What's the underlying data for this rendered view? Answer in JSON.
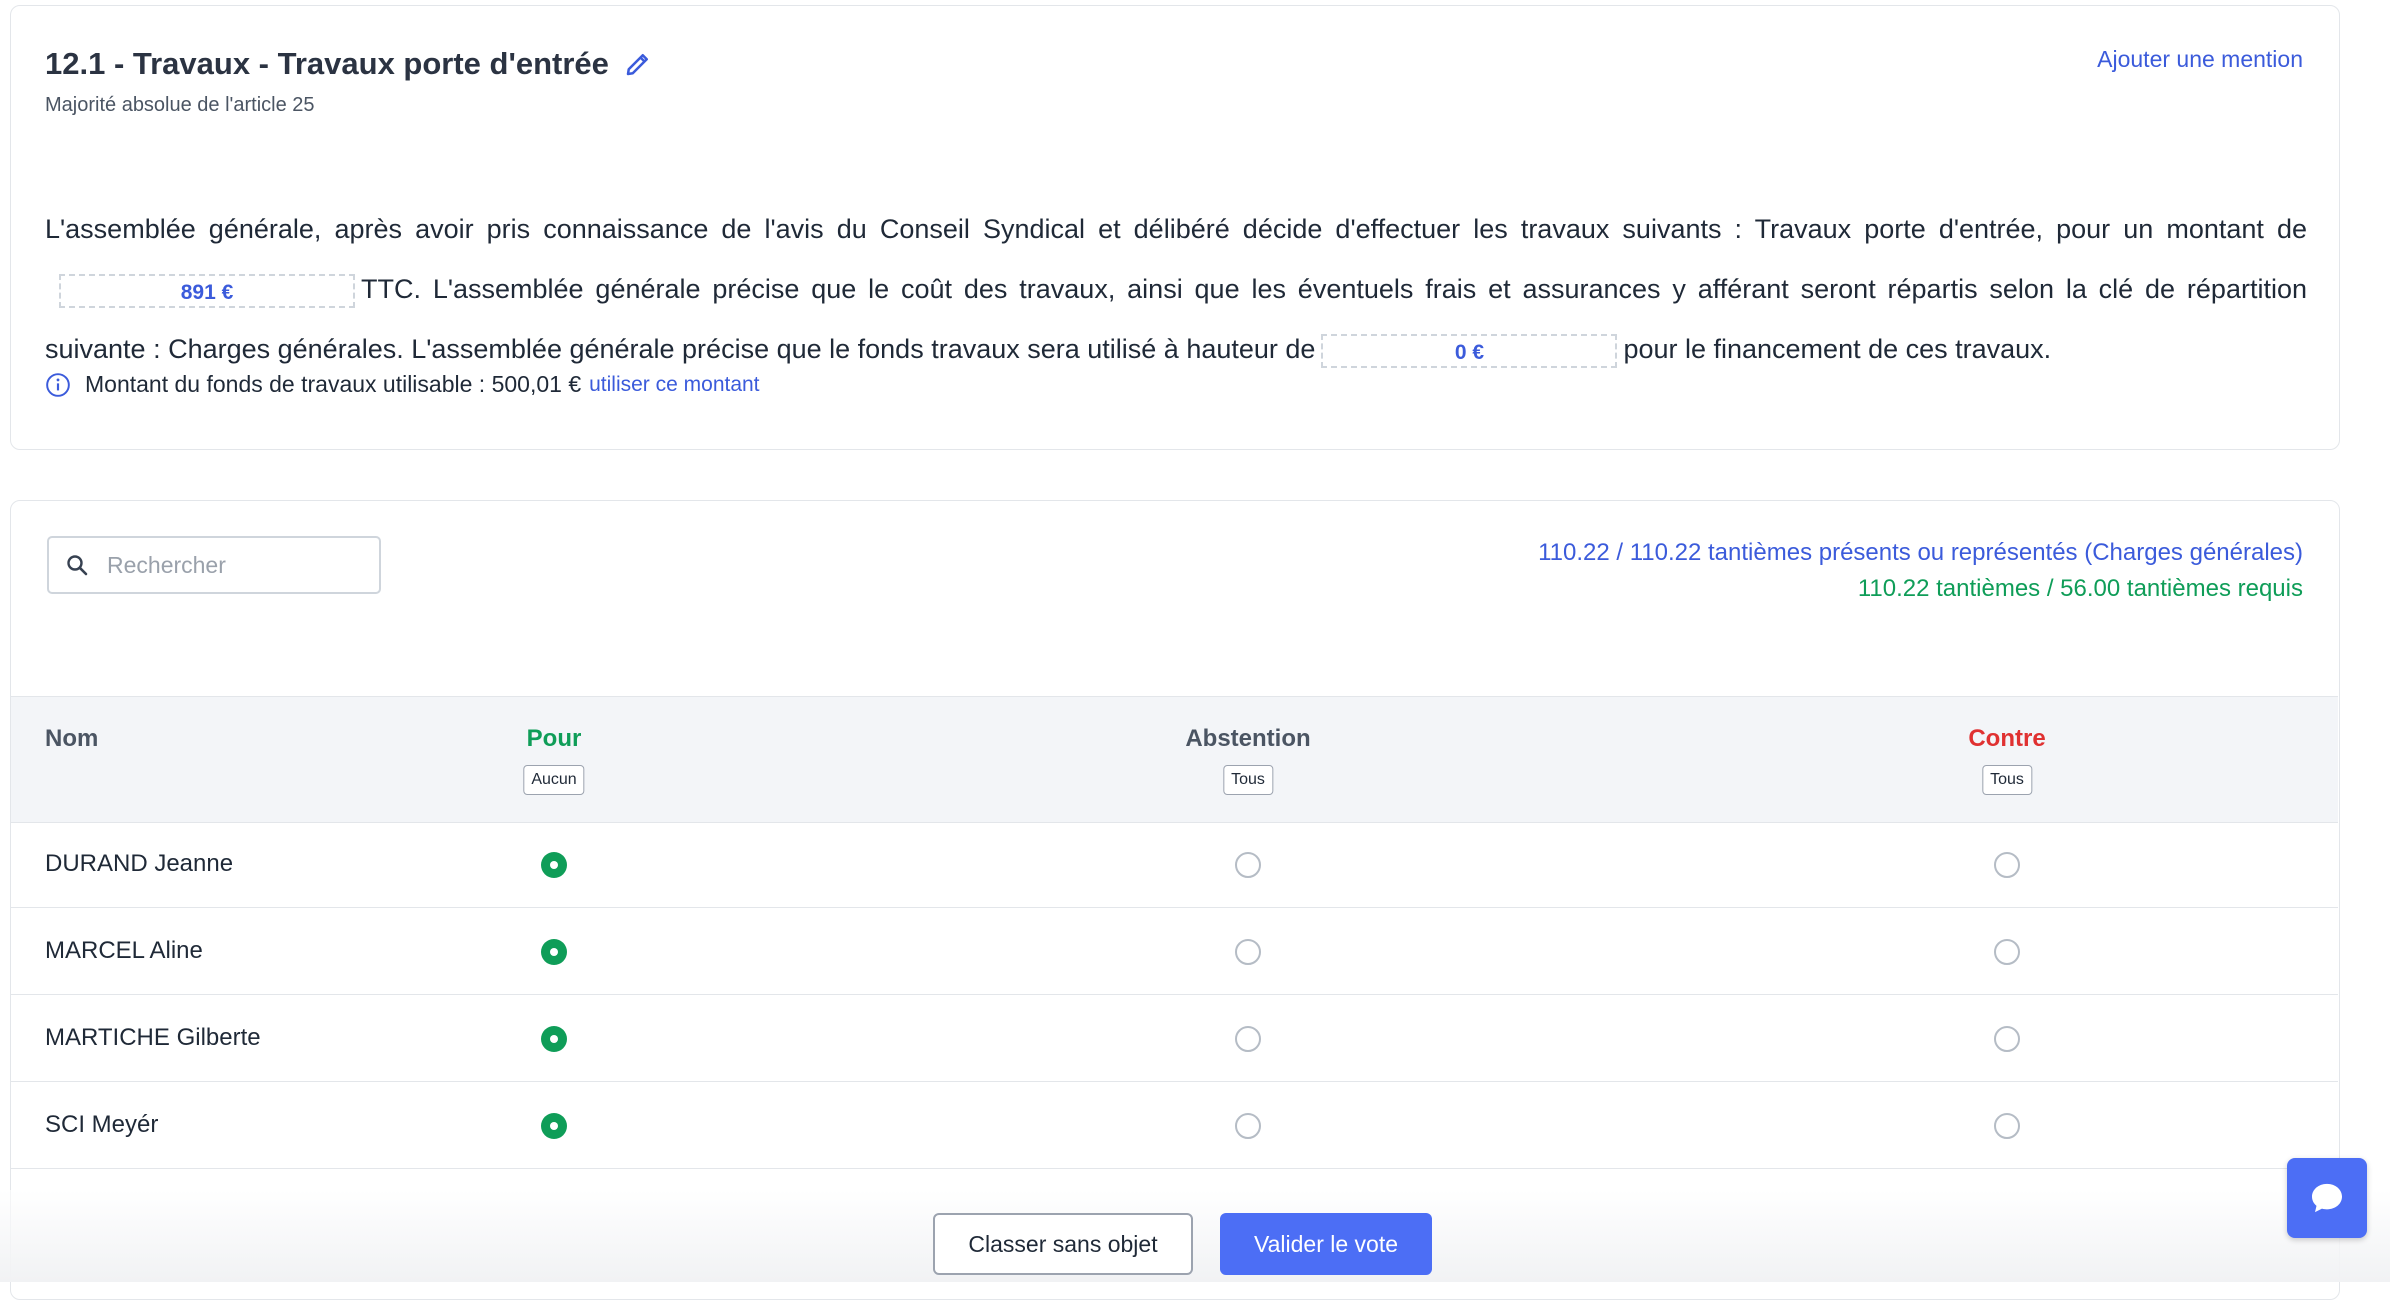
{
  "resolution": {
    "title": "12.1 - Travaux - Travaux porte d'entrée",
    "subtitle": "Majorité absolue de l'article 25",
    "add_mention": "Ajouter une mention",
    "text_part1": "L'assemblée générale, après avoir pris connaissance de l'avis du Conseil Syndical et délibéré décide d'effectuer les travaux suivants : Travaux porte d'entrée, pour un montant de",
    "amount": "891 €",
    "text_part2": "TTC. L'assemblée générale précise que le coût des travaux, ainsi que les éventuels frais et assurances y afférant seront répartis selon la clé de répartition suivante : Charges générales. L'assemblée générale précise que le fonds travaux sera utilisé à hauteur de",
    "fund_amount": "0 €",
    "text_part3": "pour le financement de ces travaux.",
    "fund_info": "Montant du fonds de travaux utilisable : 500,01 €",
    "use_amount_link": "utiliser ce montant"
  },
  "search": {
    "placeholder": "Rechercher"
  },
  "stats": {
    "present": "110.22 / 110.22 tantièmes présents ou représentés (Charges générales)",
    "required": "110.22 tantièmes / 56.00 tantièmes requis"
  },
  "table": {
    "headers": {
      "name": "Nom",
      "pour": "Pour",
      "pour_btn": "Aucun",
      "abstention": "Abstention",
      "abstention_btn": "Tous",
      "contre": "Contre",
      "contre_btn": "Tous"
    },
    "rows": [
      {
        "name": "DURAND Jeanne",
        "vote": "pour"
      },
      {
        "name": "MARCEL Aline",
        "vote": "pour"
      },
      {
        "name": "MARTICHE Gilberte",
        "vote": "pour"
      },
      {
        "name": "SCI Meyér",
        "vote": "pour"
      }
    ]
  },
  "footer": {
    "classer_label": "Classer sans objet",
    "valider_label": "Valider le vote"
  },
  "colors": {
    "accent": "#4c6ef5",
    "link": "#3b5bdb",
    "pour": "#0f9d58",
    "contre": "#e03131"
  },
  "icons": [
    "pencil-icon",
    "info-icon",
    "search-icon",
    "chat-icon"
  ]
}
